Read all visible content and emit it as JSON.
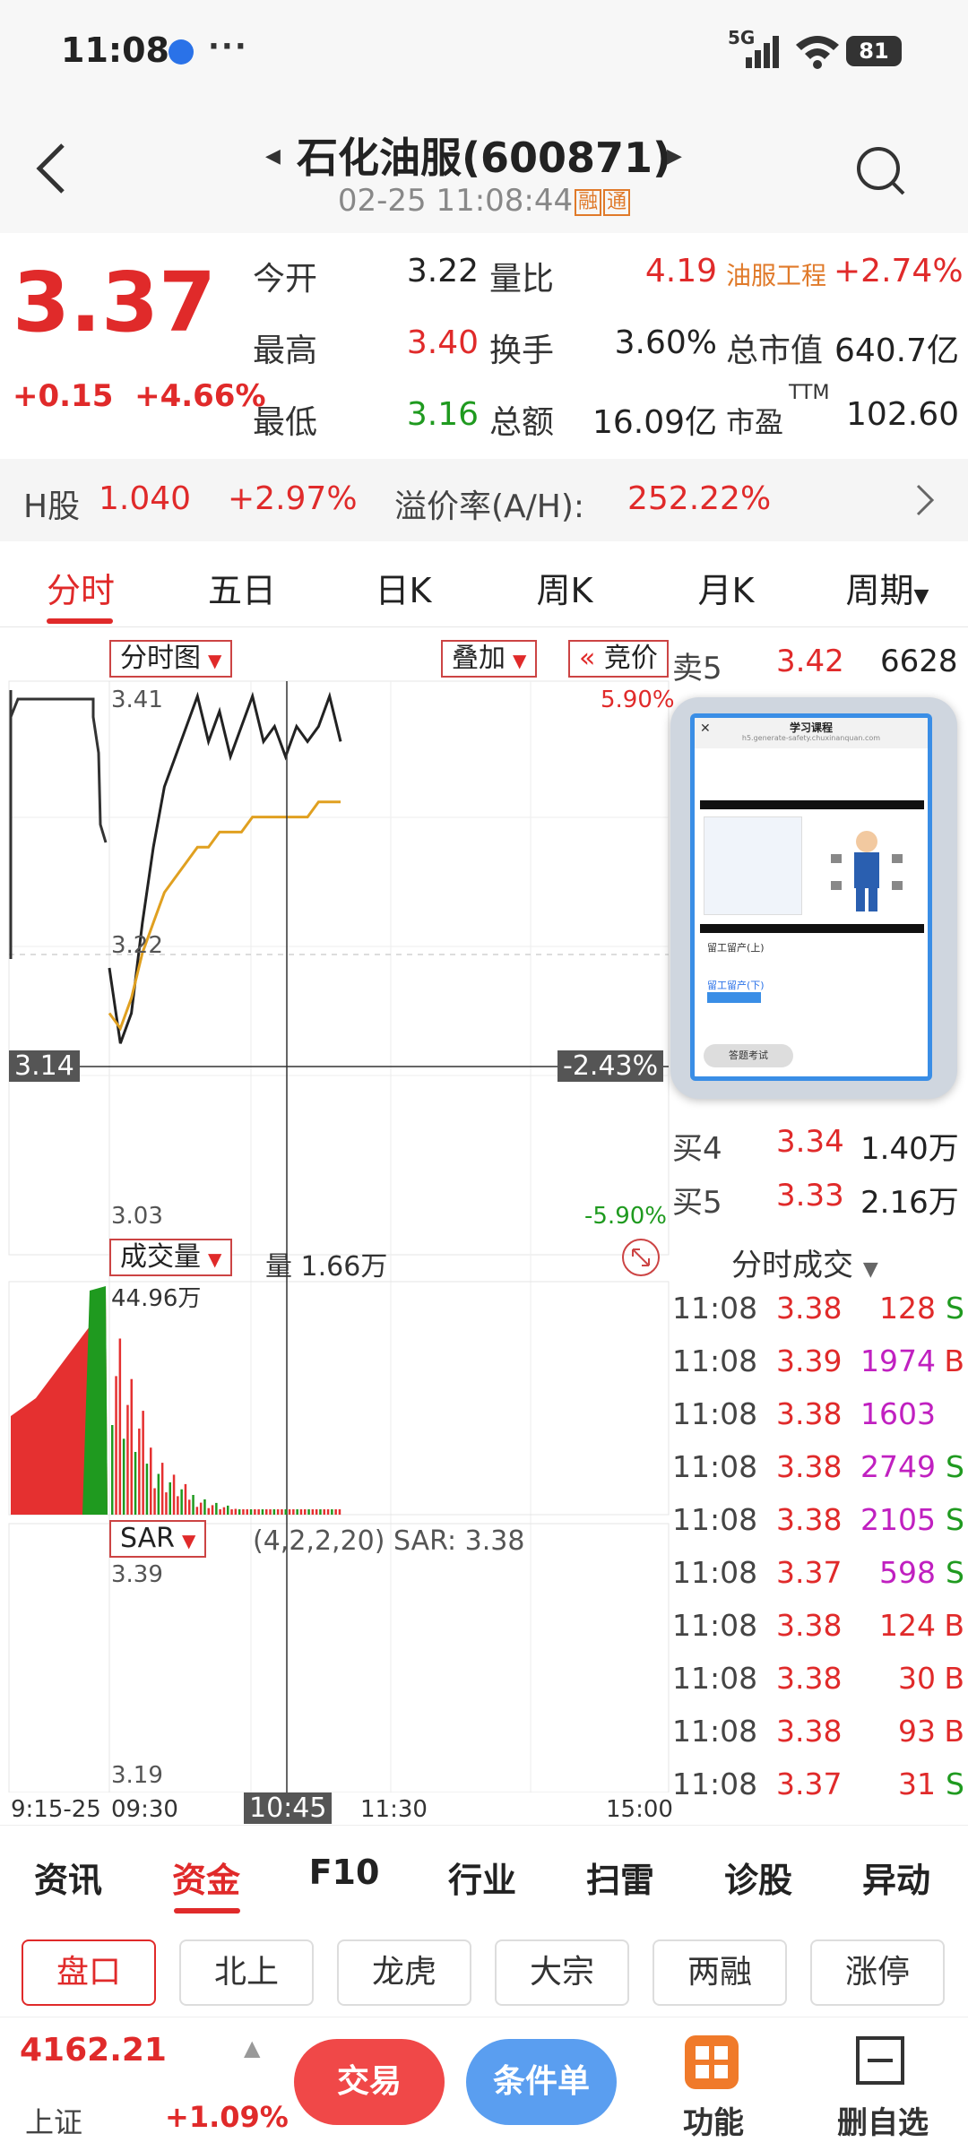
{
  "status_bar": {
    "time": "11:08",
    "signal_label": "5G",
    "battery": "81"
  },
  "header": {
    "title": "石化油服(600871)",
    "datetime": "02-25 11:08:44",
    "badge1": "融",
    "badge2": "通"
  },
  "quote": {
    "price": "3.37",
    "change": "+0.15",
    "change_pct": "+4.66%",
    "rows": [
      {
        "l1": "今开",
        "v1": "3.22",
        "l2": "量比",
        "v2": "4.19",
        "l3": "油服工程",
        "v3": "+2.74%"
      },
      {
        "l1": "最高",
        "v1": "3.40",
        "l2": "换手",
        "v2": "3.60%",
        "l3": "总市值",
        "v3": "640.7亿"
      },
      {
        "l1": "最低",
        "v1": "3.16",
        "l2": "总额",
        "v2": "16.09亿",
        "l3": "市盈",
        "l3sup": "TTM",
        "v3": "102.60"
      }
    ]
  },
  "h_share": {
    "label": "H股",
    "price": "1.040",
    "pct": "+2.97%",
    "premium_label": "溢价率(A/H):",
    "premium": "252.22%"
  },
  "tabs": [
    "分时",
    "五日",
    "日K",
    "周K",
    "月K",
    "周期"
  ],
  "chart": {
    "tag_main": "分时图",
    "tag_overlay": "叠加",
    "tag_auction": "竞价",
    "top_price": "3.41",
    "top_pct": "5.90%",
    "mid_price": "3.22",
    "low_price": "3.03",
    "low_pct": "-5.90%",
    "cursor_price": "3.14",
    "cursor_pct": "-2.43%",
    "vol_tag": "成交量",
    "vol_value": "量 1.66万",
    "vol_max": "44.96万",
    "sar_tag": "SAR",
    "sar_params": "(4,2,2,20) SAR: 3.38",
    "sar_high": "3.39",
    "sar_low": "3.19",
    "time_labels": [
      "9:15-25",
      "09:30",
      "11:30",
      "15:00"
    ],
    "cursor_time": "10:45"
  },
  "chart_data": {
    "type": "line",
    "series": [
      {
        "values": [
          3.22,
          3.17,
          3.19,
          3.25,
          3.3,
          3.34,
          3.36,
          3.38,
          3.4,
          3.37,
          3.39,
          3.36,
          3.38,
          3.4,
          3.37,
          3.38,
          3.36,
          3.38,
          3.37,
          3.38,
          3.4,
          3.37
        ]
      },
      {
        "values": [
          3.19,
          3.18,
          3.2,
          3.23,
          3.25,
          3.27,
          3.28,
          3.29,
          3.3,
          3.3,
          3.31,
          3.31,
          3.31,
          3.32,
          3.32,
          3.32,
          3.32,
          3.32,
          3.32,
          3.33,
          3.33,
          3.33
        ]
      }
    ],
    "ylim": [
      3.03,
      3.41
    ]
  },
  "order_book": {
    "asks": [
      {
        "label": "卖5",
        "price": "3.42",
        "vol": "6628"
      }
    ],
    "bids": [
      {
        "label": "买4",
        "price": "3.34",
        "vol": "1.40万"
      },
      {
        "label": "买5",
        "price": "3.33",
        "vol": "2.16万"
      }
    ]
  },
  "trades": {
    "header": "分时成交",
    "rows": [
      {
        "t": "11:08",
        "p": "3.38",
        "v": "128",
        "s": "S"
      },
      {
        "t": "11:08",
        "p": "3.39",
        "v": "1974",
        "s": "B"
      },
      {
        "t": "11:08",
        "p": "3.38",
        "v": "1603",
        "s": ""
      },
      {
        "t": "11:08",
        "p": "3.38",
        "v": "2749",
        "s": "S"
      },
      {
        "t": "11:08",
        "p": "3.38",
        "v": "2105",
        "s": "S"
      },
      {
        "t": "11:08",
        "p": "3.37",
        "v": "598",
        "s": "S"
      },
      {
        "t": "11:08",
        "p": "3.38",
        "v": "124",
        "s": "B"
      },
      {
        "t": "11:08",
        "p": "3.38",
        "v": "30",
        "s": "B"
      },
      {
        "t": "11:08",
        "p": "3.38",
        "v": "93",
        "s": "B"
      },
      {
        "t": "11:08",
        "p": "3.37",
        "v": "31",
        "s": "S"
      }
    ]
  },
  "overlay": {
    "title": "学习课程",
    "url": "h5.generate-safety.chuxinanquan.com",
    "item1": "留工留产(上)",
    "item2": "留工留产(下)",
    "btn": "答题考试"
  },
  "subnav": [
    "资讯",
    "资金",
    "F10",
    "行业",
    "扫雷",
    "诊股",
    "异动"
  ],
  "pills": [
    "盘口",
    "北上",
    "龙虎",
    "大宗",
    "两融",
    "涨停"
  ],
  "bottom": {
    "index_value": "4162.21",
    "index_name": "上证",
    "index_pct": "+1.09%",
    "trade": "交易",
    "condition": "条件单",
    "func": "功能",
    "remove": "删自选"
  }
}
